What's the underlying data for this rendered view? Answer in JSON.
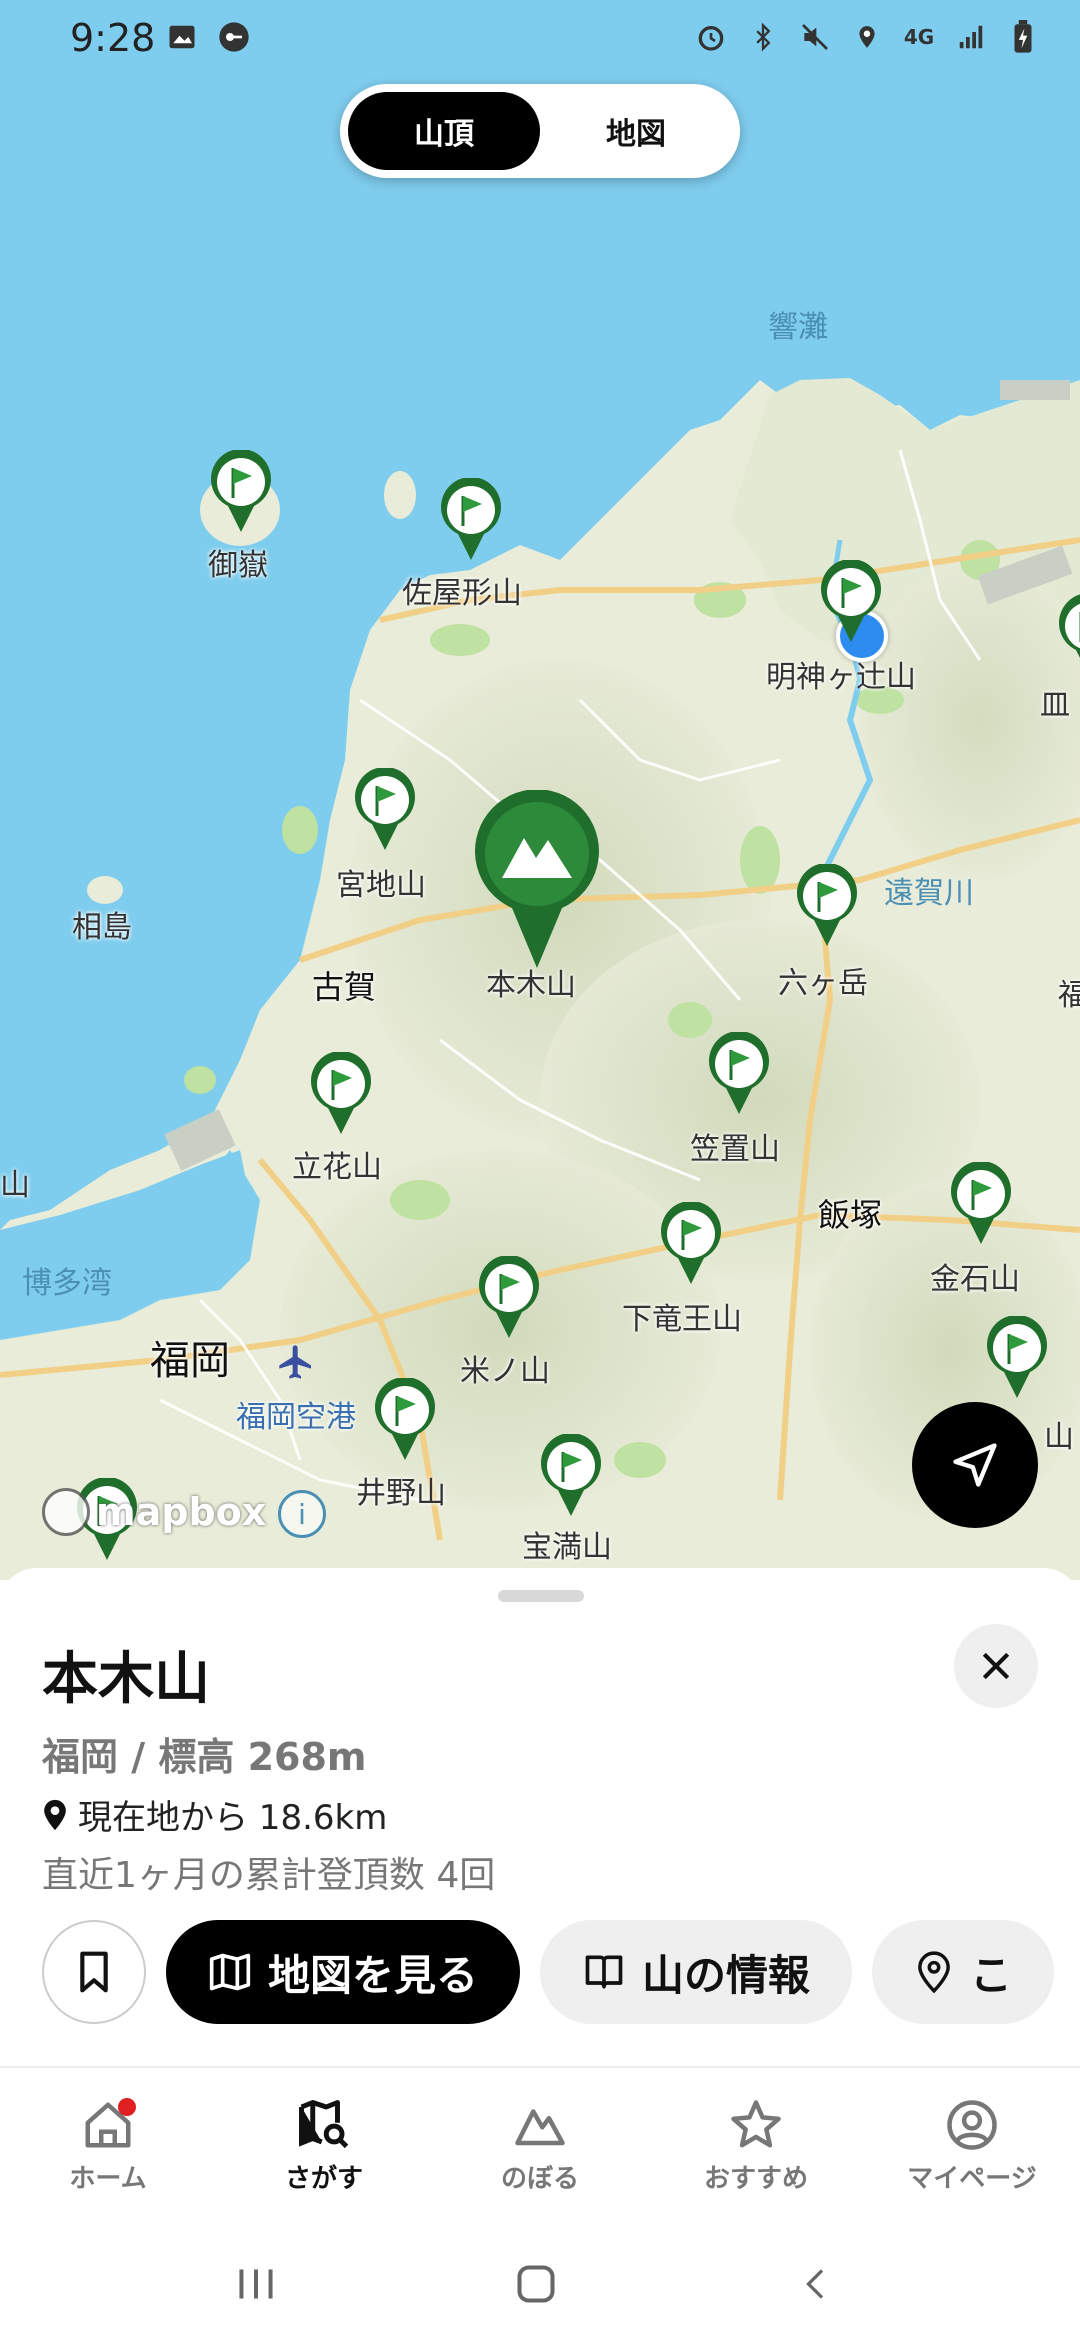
{
  "status_bar": {
    "time": "9:28",
    "network": "4G"
  },
  "segment": {
    "summit_label": "山頂",
    "map_label": "地図",
    "selected": "山頂"
  },
  "map": {
    "water_labels": {
      "sea_north": "響灘",
      "bay": "博多湾",
      "island_small": "相島"
    },
    "place_labels": {
      "koga": "古賀",
      "iizuka": "飯塚",
      "fukuoka": "福岡",
      "airport": "福岡空港",
      "river": "遠賀川"
    },
    "peaks": {
      "mitake": "御嶽",
      "sayagata": "佐屋形山",
      "myoujin": "明神ヶ辻山",
      "miyaji": "宮地山",
      "honki": "本木山",
      "rokkadake": "六ヶ岳",
      "tachibana": "立花山",
      "kasagi": "笠置山",
      "kinseki": "金石山",
      "karyuuou": "下竜王山",
      "yoneno": "米ノ山",
      "ino": "井野山",
      "houman": "宝満山"
    },
    "edge_labels": {
      "right_top": "皿",
      "right_mid": "福",
      "left_mid": "山",
      "right_low": "山"
    },
    "attribution": "mapbox"
  },
  "detail": {
    "title": "本木山",
    "meta": "福岡 / 標高 268m",
    "distance": "現在地から 18.6km",
    "climbs": "直近1ヶ月の累計登頂数 4回",
    "view_map_label": "地図を見る",
    "info_label": "山の情報",
    "partial_label": "こ"
  },
  "nav": {
    "home": "ホーム",
    "search": "さがす",
    "climb": "のぼる",
    "recommend": "おすすめ",
    "mypage": "マイページ"
  },
  "colors": {
    "pin_green": "#1f6e2b",
    "map_water": "#7fcdee",
    "map_land": "#e8ecd8"
  }
}
